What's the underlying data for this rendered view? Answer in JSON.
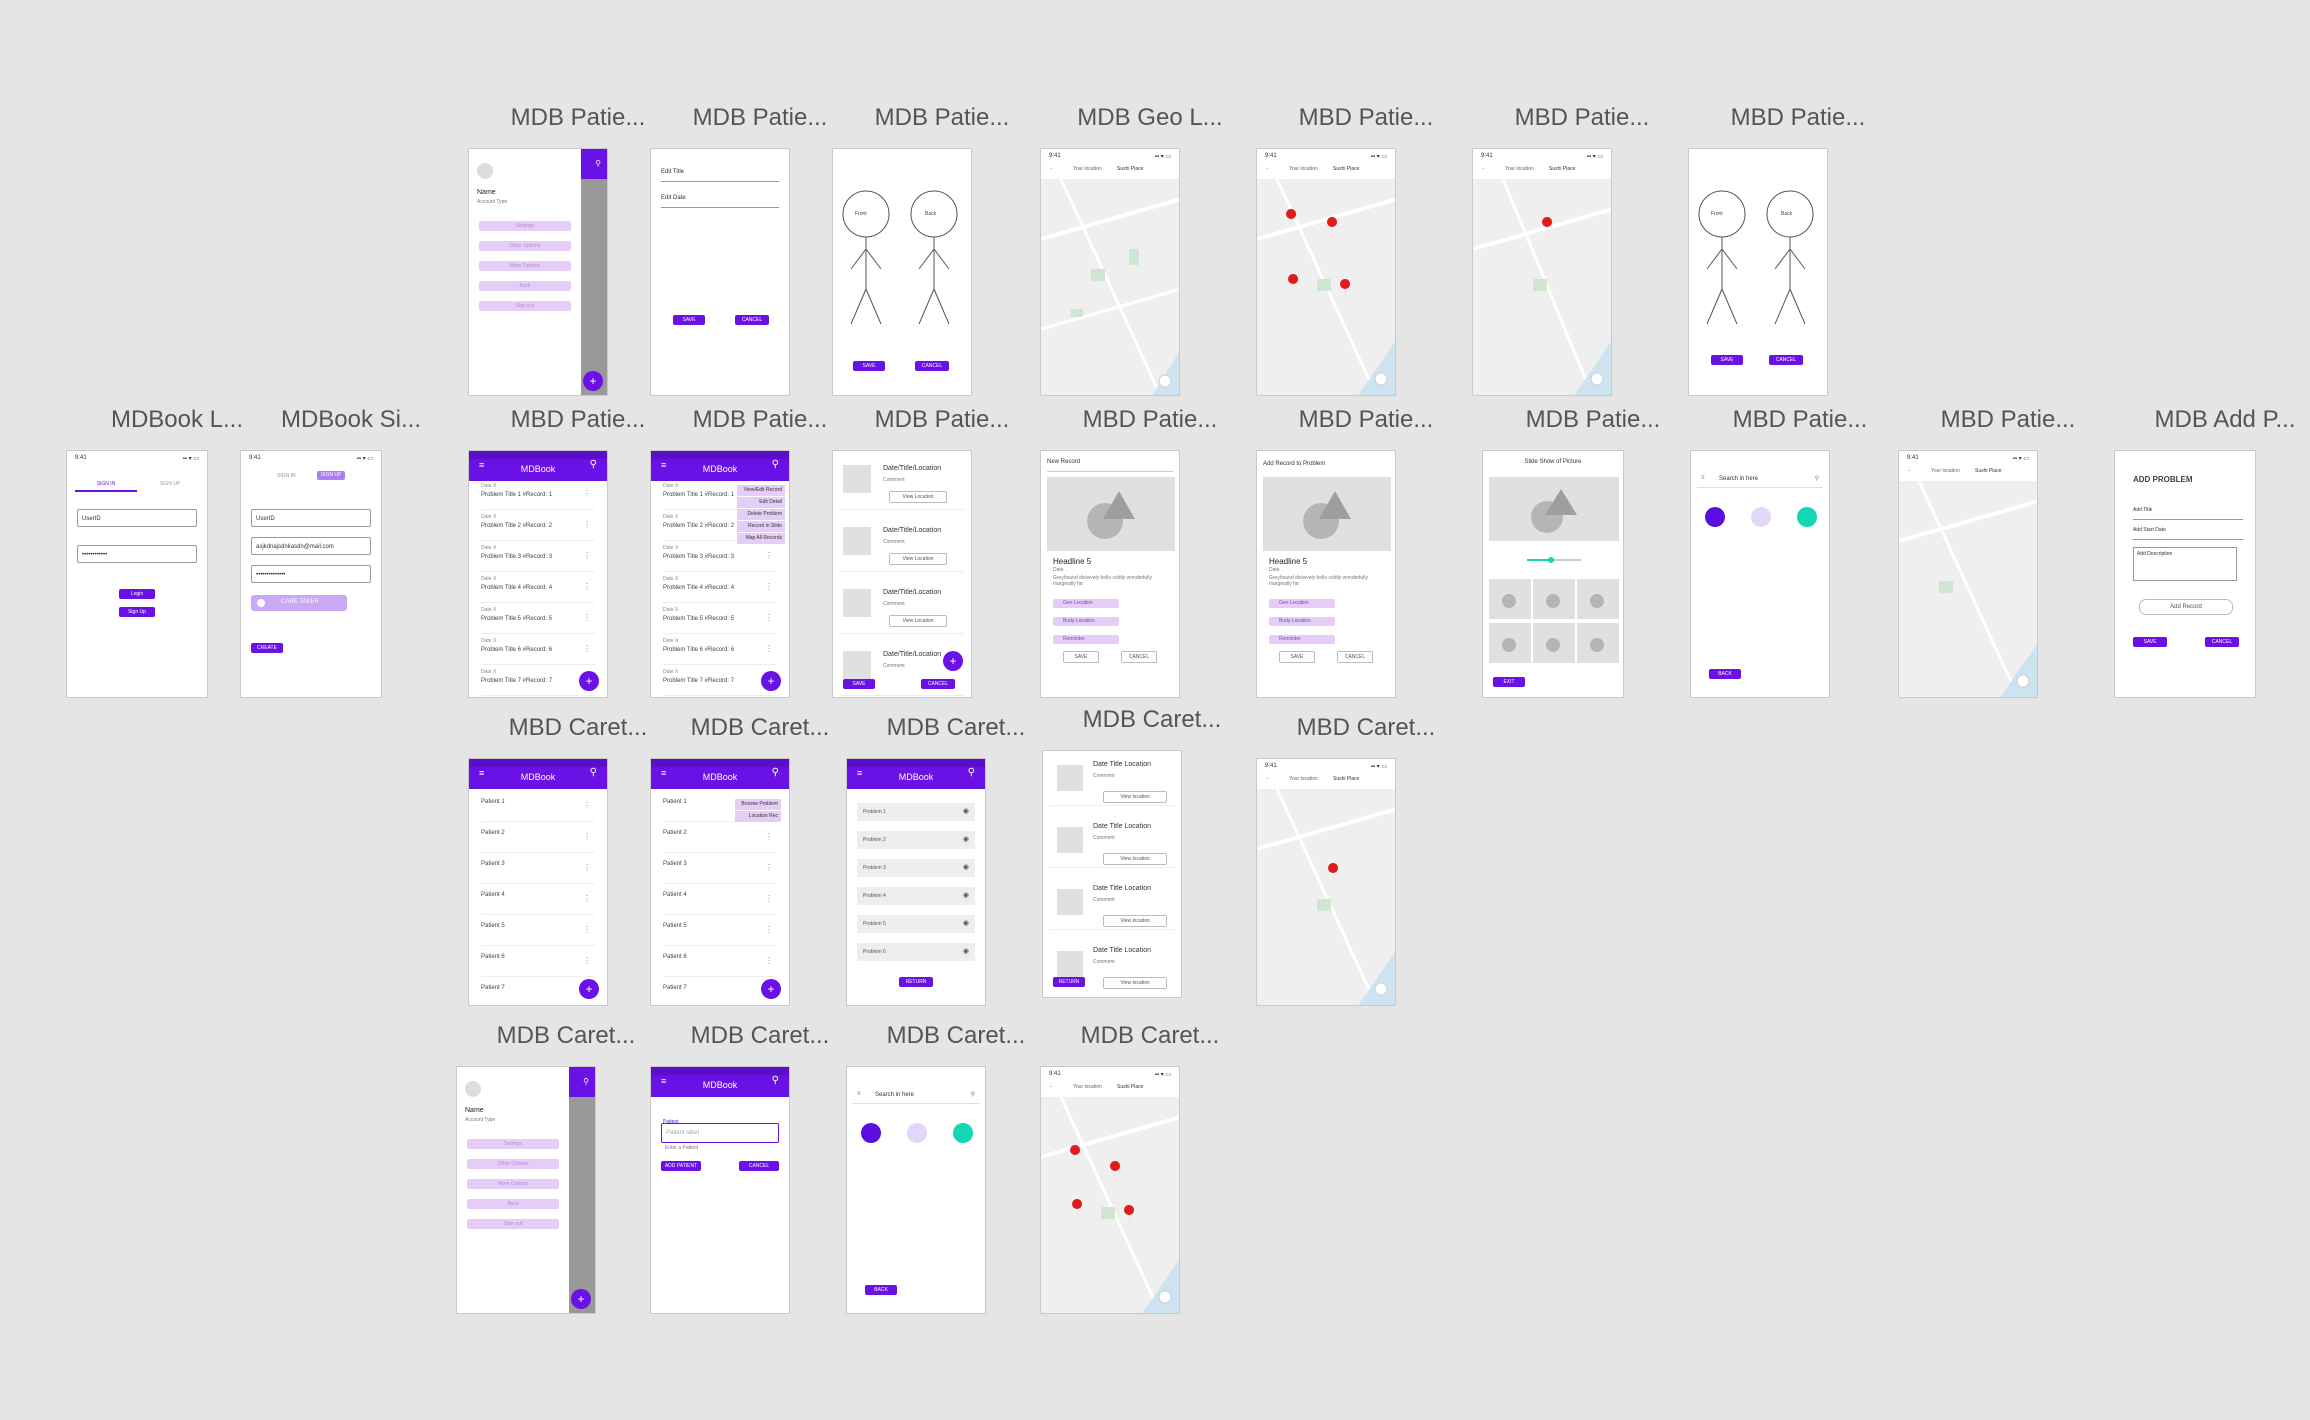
{
  "boards": {
    "r1": [
      "MDB Patie...",
      "MDB Patie...",
      "MDB Patie...",
      "MDB Geo L...",
      "MBD Patie...",
      "MBD Patie...",
      "MBD Patie..."
    ],
    "r2": [
      "MDBook L...",
      "MDBook Si...",
      "MBD Patie...",
      "MDB Patie...",
      "MDB Patie...",
      "MBD Patie...",
      "MBD Patie...",
      "MDB Patie...",
      "MBD Patie...",
      "MBD Patie...",
      "MDB Add P..."
    ],
    "r3": [
      "MBD Caret...",
      "MDB Caret...",
      "MDB Caret...",
      "MDB Caret...",
      "MBD Caret..."
    ],
    "r4": [
      "MDB Caret...",
      "MDB Caret...",
      "MDB Caret...",
      "MDB Caret..."
    ]
  },
  "common": {
    "time": "9:41",
    "app_title": "MDBook",
    "menu_icon": "≡",
    "search_icon": "⚲",
    "kebab": "⋮",
    "fab_plus": "+",
    "save": "SAVE",
    "cancel": "CANCEL",
    "back": "BACK",
    "return": "RETURN",
    "exit": "EXIT",
    "your_location": "Your location",
    "place": "Sushi Place",
    "search_here": "Search in here",
    "view_location": "View Location",
    "view_location_lc": "View location"
  },
  "drawer": {
    "name": "Name",
    "account_type": "Account Type",
    "items": [
      "Settings",
      "Other Options",
      "More Options",
      "Back",
      "Sign out"
    ]
  },
  "edit_problem": {
    "title_label": "Edit Title",
    "date_label": "Edit Date"
  },
  "figure": {
    "front": "Front",
    "back": "Back"
  },
  "login": {
    "tab_signin": "SIGN IN",
    "tab_signup": "SIGN UP",
    "user_label": "Email",
    "user_value": "UserID",
    "pass_label": "Password",
    "pass_value": "••••••••••••",
    "login_btn": "Login",
    "signin_btn": "Sign Up"
  },
  "signup": {
    "tab_signin": "SIGN IN",
    "tab_signup": "SIGN UP",
    "user_value": "UserID",
    "email_value": "asjkdnajsdnkasdn@mail.com",
    "pass_value": "••••••••••••••",
    "caretaker": "CARE TAKER",
    "create": "CREATE"
  },
  "records": {
    "date_label": "Date X",
    "rows": [
      "Problem Title 1  #Record: 1",
      "Problem Title 2  #Record: 2",
      "Problem Title 3  #Record: 3",
      "Problem Title 4  #Record: 4",
      "Problem Title 5  #Record: 5",
      "Problem Title 6  #Record: 6",
      "Problem Title 7  #Record: 7"
    ],
    "menu": [
      "View/Edit Record",
      "Edit Detail",
      "Delete Problem",
      "Record in Slide",
      "Map All Records"
    ]
  },
  "dtl": {
    "title": "Date/Title/Location",
    "comment": "Comment"
  },
  "new_record": {
    "title": "New Record",
    "title2": "Add Record to Problem",
    "headline": "Headline 5",
    "date": "Date",
    "body": "Greyhound divisively hello coldly wonderfully marginally far",
    "chips": [
      "Geo Location",
      "Body Location",
      "Reminder"
    ]
  },
  "slideshow": {
    "title": "Slide Show of Picture"
  },
  "add_problem": {
    "title": "ADD PROBLEM",
    "f1": "Add Title",
    "f2": "Add Start Date",
    "f3": "Add Description",
    "add_record": "Add Record"
  },
  "patients": {
    "rows": [
      "Patient 1",
      "Patient 2",
      "Patient 3",
      "Patient 4",
      "Patient 5",
      "Patient 6",
      "Patient 7"
    ],
    "menu": [
      "Browse Problem",
      "Location Rec"
    ]
  },
  "problems": {
    "rows": [
      "Problem 1",
      "Problem 2",
      "Problem 3",
      "Problem 4",
      "Problem 5",
      "Problem 6"
    ]
  },
  "dtl2": {
    "title": "Date Title Location",
    "comment": "Comment"
  },
  "add_patient": {
    "label": "Patient",
    "placeholder": "Patient label",
    "helper": "Enter a Patient",
    "add": "ADD PATIENT",
    "cancel": "CANCEL"
  },
  "colors": {
    "primary": "#6a11e6",
    "chip": "#e6cdf7",
    "teal": "#12d6b4",
    "lavender": "#e3d7f7",
    "pin": "#e01b1b"
  }
}
